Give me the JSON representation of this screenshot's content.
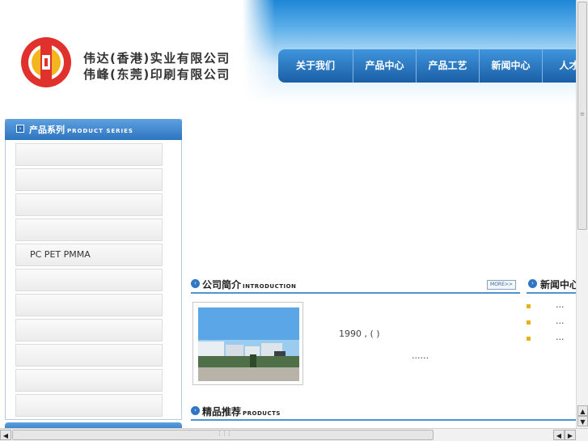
{
  "header": {
    "company_line1": "伟达(香港)实业有限公司",
    "company_line2": "伟峰(东莞)印刷有限公司"
  },
  "nav": [
    "关于我们",
    "产品中心",
    "产品工艺",
    "新闻中心",
    "人才招"
  ],
  "sidebar": {
    "title": "产品系列",
    "title_en": "PRODUCT SERIES",
    "items": [
      "",
      "",
      "",
      "",
      "PC PET PMMA",
      "",
      "",
      "",
      "",
      "",
      ""
    ]
  },
  "intro": {
    "title": "公司简介",
    "title_en": "INTRODUCTION",
    "more": "MORE>>",
    "line1": "1990 , ( )",
    "line2": "......"
  },
  "news": {
    "title": "新闻中心",
    "items": [
      "...",
      "...",
      "..."
    ]
  },
  "products": {
    "title": "精品推荐",
    "title_en": "PRODUCTS"
  },
  "colors": {
    "nav_blue": "#1b5fa6",
    "accent_blue": "#4f93d4",
    "bullet_gold": "#e3b317",
    "logo_red": "#e0312c",
    "logo_gold": "#f3b61f"
  }
}
